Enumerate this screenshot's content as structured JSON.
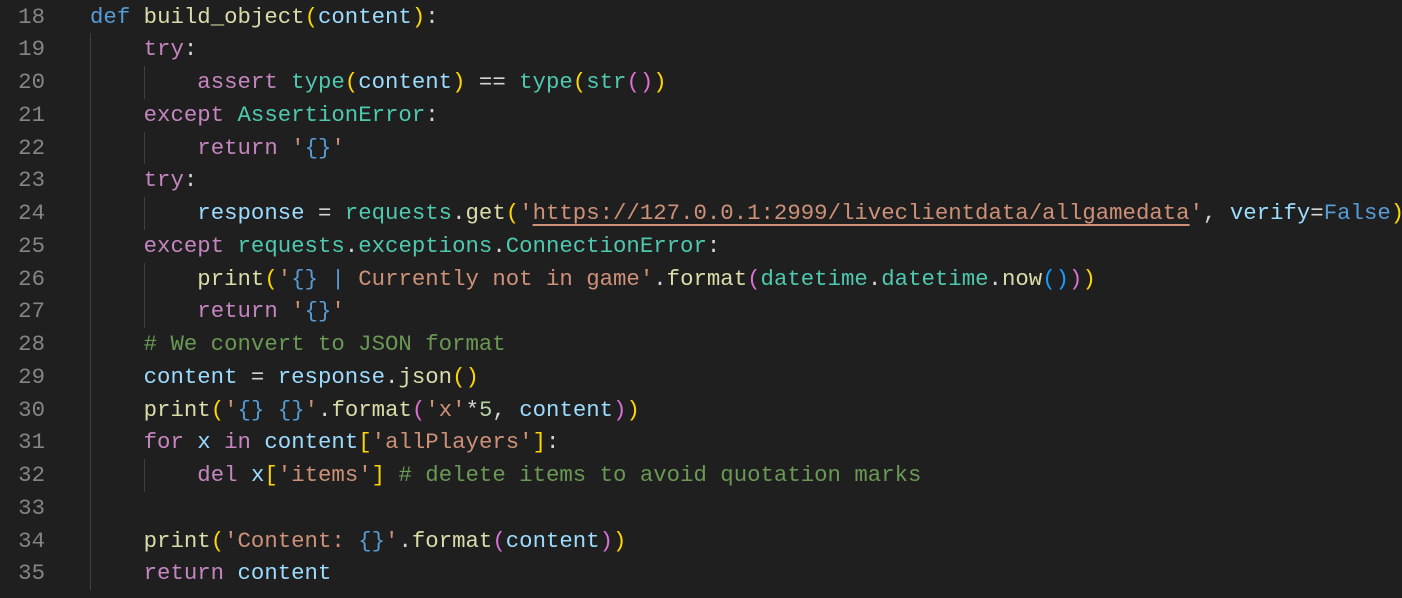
{
  "editor": {
    "colors": {
      "background": "#1f1f1f",
      "line_number": "#858585",
      "keyword": "#569cd6",
      "control": "#c586c0",
      "function": "#dcdcaa",
      "variable": "#9cdcfe",
      "class": "#4ec9b0",
      "string": "#ce9178",
      "comment": "#6a9955"
    },
    "lines": [
      {
        "n": "18",
        "indent": 0,
        "tokens": [
          [
            "def",
            "def"
          ],
          [
            " ",
            "p"
          ],
          [
            "build_object",
            "fn"
          ],
          [
            "(",
            "b1"
          ],
          [
            "content",
            "var"
          ],
          [
            ")",
            "b1"
          ],
          [
            ":",
            "p"
          ]
        ]
      },
      {
        "n": "19",
        "indent": 1,
        "tokens": [
          [
            "    ",
            "p"
          ],
          [
            "try",
            "ctrl"
          ],
          [
            ":",
            "p"
          ]
        ]
      },
      {
        "n": "20",
        "indent": 2,
        "tokens": [
          [
            "        ",
            "p"
          ],
          [
            "assert",
            "ctrl"
          ],
          [
            " ",
            "p"
          ],
          [
            "type",
            "cls"
          ],
          [
            "(",
            "b1"
          ],
          [
            "content",
            "var"
          ],
          [
            ")",
            "b1"
          ],
          [
            " == ",
            "p"
          ],
          [
            "type",
            "cls"
          ],
          [
            "(",
            "b1"
          ],
          [
            "str",
            "cls"
          ],
          [
            "(",
            "b2"
          ],
          [
            ")",
            "b2"
          ],
          [
            ")",
            "b1"
          ]
        ]
      },
      {
        "n": "21",
        "indent": 1,
        "tokens": [
          [
            "    ",
            "p"
          ],
          [
            "except",
            "ctrl"
          ],
          [
            " ",
            "p"
          ],
          [
            "AssertionError",
            "cls"
          ],
          [
            ":",
            "p"
          ]
        ]
      },
      {
        "n": "22",
        "indent": 2,
        "tokens": [
          [
            "        ",
            "p"
          ],
          [
            "return",
            "ctrl"
          ],
          [
            " ",
            "p"
          ],
          [
            "'",
            "str"
          ],
          [
            "{}",
            "def"
          ],
          [
            "'",
            "str"
          ]
        ]
      },
      {
        "n": "23",
        "indent": 1,
        "tokens": [
          [
            "    ",
            "p"
          ],
          [
            "try",
            "ctrl"
          ],
          [
            ":",
            "p"
          ]
        ]
      },
      {
        "n": "24",
        "indent": 2,
        "tokens": [
          [
            "        ",
            "p"
          ],
          [
            "response",
            "var"
          ],
          [
            " = ",
            "p"
          ],
          [
            "requests",
            "cls"
          ],
          [
            ".",
            "p"
          ],
          [
            "get",
            "fn"
          ],
          [
            "(",
            "b1"
          ],
          [
            "'",
            "str"
          ],
          [
            "https://127.0.0.1:2999/liveclientdata/allgamedata",
            "url"
          ],
          [
            "'",
            "str"
          ],
          [
            ", ",
            "p"
          ],
          [
            "verify",
            "var"
          ],
          [
            "=",
            "p"
          ],
          [
            "False",
            "def"
          ],
          [
            ")",
            "b1"
          ]
        ]
      },
      {
        "n": "25",
        "indent": 1,
        "tokens": [
          [
            "    ",
            "p"
          ],
          [
            "except",
            "ctrl"
          ],
          [
            " ",
            "p"
          ],
          [
            "requests",
            "cls"
          ],
          [
            ".",
            "p"
          ],
          [
            "exceptions",
            "cls"
          ],
          [
            ".",
            "p"
          ],
          [
            "ConnectionError",
            "cls"
          ],
          [
            ":",
            "p"
          ]
        ]
      },
      {
        "n": "26",
        "indent": 2,
        "tokens": [
          [
            "        ",
            "p"
          ],
          [
            "print",
            "fn"
          ],
          [
            "(",
            "b1"
          ],
          [
            "'",
            "str"
          ],
          [
            "{}",
            "def"
          ],
          [
            " ",
            "str"
          ],
          [
            "|",
            "def"
          ],
          [
            " Currently not in game'",
            "str"
          ],
          [
            ".",
            "p"
          ],
          [
            "format",
            "fn"
          ],
          [
            "(",
            "b2"
          ],
          [
            "datetime",
            "cls"
          ],
          [
            ".",
            "p"
          ],
          [
            "datetime",
            "cls"
          ],
          [
            ".",
            "p"
          ],
          [
            "now",
            "fn"
          ],
          [
            "(",
            "b3"
          ],
          [
            ")",
            "b3"
          ],
          [
            ")",
            "b2"
          ],
          [
            ")",
            "b1"
          ]
        ]
      },
      {
        "n": "27",
        "indent": 2,
        "tokens": [
          [
            "        ",
            "p"
          ],
          [
            "return",
            "ctrl"
          ],
          [
            " ",
            "p"
          ],
          [
            "'",
            "str"
          ],
          [
            "{}",
            "def"
          ],
          [
            "'",
            "str"
          ]
        ]
      },
      {
        "n": "28",
        "indent": 1,
        "tokens": [
          [
            "    ",
            "p"
          ],
          [
            "# We convert to JSON format",
            "com"
          ]
        ]
      },
      {
        "n": "29",
        "indent": 1,
        "tokens": [
          [
            "    ",
            "p"
          ],
          [
            "content",
            "var"
          ],
          [
            " = ",
            "p"
          ],
          [
            "response",
            "var"
          ],
          [
            ".",
            "p"
          ],
          [
            "json",
            "fn"
          ],
          [
            "(",
            "b1"
          ],
          [
            ")",
            "b1"
          ]
        ]
      },
      {
        "n": "30",
        "indent": 1,
        "tokens": [
          [
            "    ",
            "p"
          ],
          [
            "print",
            "fn"
          ],
          [
            "(",
            "b1"
          ],
          [
            "'",
            "str"
          ],
          [
            "{}",
            "def"
          ],
          [
            " ",
            "str"
          ],
          [
            "{}",
            "def"
          ],
          [
            "'",
            "str"
          ],
          [
            ".",
            "p"
          ],
          [
            "format",
            "fn"
          ],
          [
            "(",
            "b2"
          ],
          [
            "'x'",
            "str"
          ],
          [
            "*",
            "p"
          ],
          [
            "5",
            "num"
          ],
          [
            ", ",
            "p"
          ],
          [
            "content",
            "var"
          ],
          [
            ")",
            "b2"
          ],
          [
            ")",
            "b1"
          ]
        ]
      },
      {
        "n": "31",
        "indent": 1,
        "tokens": [
          [
            "    ",
            "p"
          ],
          [
            "for",
            "ctrl"
          ],
          [
            " ",
            "p"
          ],
          [
            "x",
            "var"
          ],
          [
            " ",
            "p"
          ],
          [
            "in",
            "ctrl"
          ],
          [
            " ",
            "p"
          ],
          [
            "content",
            "var"
          ],
          [
            "[",
            "b1"
          ],
          [
            "'allPlayers'",
            "str"
          ],
          [
            "]",
            "b1"
          ],
          [
            ":",
            "p"
          ]
        ]
      },
      {
        "n": "32",
        "indent": 2,
        "tokens": [
          [
            "        ",
            "p"
          ],
          [
            "del",
            "ctrl"
          ],
          [
            " ",
            "p"
          ],
          [
            "x",
            "var"
          ],
          [
            "[",
            "b1"
          ],
          [
            "'items'",
            "str"
          ],
          [
            "]",
            "b1"
          ],
          [
            " ",
            "p"
          ],
          [
            "# delete items to avoid quotation marks",
            "com"
          ]
        ]
      },
      {
        "n": "33",
        "indent": 1,
        "tokens": []
      },
      {
        "n": "34",
        "indent": 1,
        "tokens": [
          [
            "    ",
            "p"
          ],
          [
            "print",
            "fn"
          ],
          [
            "(",
            "b1"
          ],
          [
            "'Content: ",
            "str"
          ],
          [
            "{}",
            "def"
          ],
          [
            "'",
            "str"
          ],
          [
            ".",
            "p"
          ],
          [
            "format",
            "fn"
          ],
          [
            "(",
            "b2"
          ],
          [
            "content",
            "var"
          ],
          [
            ")",
            "b2"
          ],
          [
            ")",
            "b1"
          ]
        ]
      },
      {
        "n": "35",
        "indent": 1,
        "tokens": [
          [
            "    ",
            "p"
          ],
          [
            "return",
            "ctrl"
          ],
          [
            " ",
            "p"
          ],
          [
            "content",
            "var"
          ]
        ]
      }
    ]
  }
}
